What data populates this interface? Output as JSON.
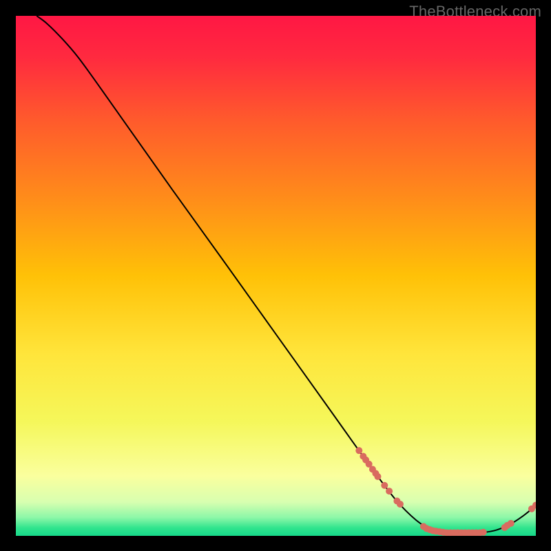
{
  "watermark": {
    "text": "TheBottleneck.com"
  },
  "chart_data": {
    "type": "line",
    "title": "",
    "xlabel": "",
    "ylabel": "",
    "xlim": [
      0,
      100
    ],
    "ylim": [
      0,
      100
    ],
    "grid": false,
    "legend": false,
    "background_gradient": {
      "stops": [
        {
          "offset": 0.0,
          "color": "#ff1744"
        },
        {
          "offset": 0.08,
          "color": "#ff2a3f"
        },
        {
          "offset": 0.2,
          "color": "#ff5a2c"
        },
        {
          "offset": 0.35,
          "color": "#ff8c1a"
        },
        {
          "offset": 0.5,
          "color": "#ffc107"
        },
        {
          "offset": 0.65,
          "color": "#ffe53b"
        },
        {
          "offset": 0.78,
          "color": "#f5f75a"
        },
        {
          "offset": 0.885,
          "color": "#faff9e"
        },
        {
          "offset": 0.935,
          "color": "#d8ffb0"
        },
        {
          "offset": 0.965,
          "color": "#8cf7a8"
        },
        {
          "offset": 0.985,
          "color": "#2fe48d"
        },
        {
          "offset": 1.0,
          "color": "#17d88a"
        }
      ]
    },
    "series": [
      {
        "name": "bottleneck-curve",
        "type": "line",
        "color": "#000000",
        "data": [
          {
            "x": 4.0,
            "y": 100.0
          },
          {
            "x": 6.0,
            "y": 98.5
          },
          {
            "x": 9.0,
            "y": 95.5
          },
          {
            "x": 12.0,
            "y": 92.0
          },
          {
            "x": 16.0,
            "y": 86.5
          },
          {
            "x": 22.0,
            "y": 78.0
          },
          {
            "x": 30.0,
            "y": 66.7
          },
          {
            "x": 40.0,
            "y": 52.8
          },
          {
            "x": 50.0,
            "y": 38.8
          },
          {
            "x": 60.0,
            "y": 24.8
          },
          {
            "x": 68.0,
            "y": 13.6
          },
          {
            "x": 73.0,
            "y": 7.0
          },
          {
            "x": 77.0,
            "y": 3.0
          },
          {
            "x": 80.0,
            "y": 1.2
          },
          {
            "x": 83.0,
            "y": 0.6
          },
          {
            "x": 88.0,
            "y": 0.5
          },
          {
            "x": 92.0,
            "y": 1.0
          },
          {
            "x": 95.0,
            "y": 2.2
          },
          {
            "x": 97.5,
            "y": 3.8
          },
          {
            "x": 100.0,
            "y": 5.8
          }
        ]
      },
      {
        "name": "highlight-dots",
        "type": "scatter",
        "color": "#d96b5f",
        "radius_approx": 5,
        "data": [
          {
            "x": 66.0,
            "y": 16.4
          },
          {
            "x": 66.8,
            "y": 15.3
          },
          {
            "x": 67.3,
            "y": 14.6
          },
          {
            "x": 67.9,
            "y": 13.8
          },
          {
            "x": 68.6,
            "y": 12.8
          },
          {
            "x": 69.2,
            "y": 12.0
          },
          {
            "x": 69.6,
            "y": 11.4
          },
          {
            "x": 70.9,
            "y": 9.7
          },
          {
            "x": 71.8,
            "y": 8.6
          },
          {
            "x": 73.3,
            "y": 6.7
          },
          {
            "x": 73.9,
            "y": 6.1
          },
          {
            "x": 78.4,
            "y": 1.8
          },
          {
            "x": 79.0,
            "y": 1.4
          },
          {
            "x": 79.6,
            "y": 1.2
          },
          {
            "x": 80.2,
            "y": 1.0
          },
          {
            "x": 80.8,
            "y": 0.9
          },
          {
            "x": 81.5,
            "y": 0.8
          },
          {
            "x": 82.2,
            "y": 0.7
          },
          {
            "x": 82.9,
            "y": 0.6
          },
          {
            "x": 83.6,
            "y": 0.6
          },
          {
            "x": 84.3,
            "y": 0.6
          },
          {
            "x": 85.0,
            "y": 0.6
          },
          {
            "x": 85.7,
            "y": 0.6
          },
          {
            "x": 86.4,
            "y": 0.6
          },
          {
            "x": 87.1,
            "y": 0.6
          },
          {
            "x": 87.8,
            "y": 0.6
          },
          {
            "x": 88.5,
            "y": 0.6
          },
          {
            "x": 89.2,
            "y": 0.6
          },
          {
            "x": 89.9,
            "y": 0.7
          },
          {
            "x": 94.0,
            "y": 1.6
          },
          {
            "x": 94.5,
            "y": 2.0
          },
          {
            "x": 95.2,
            "y": 2.4
          },
          {
            "x": 99.2,
            "y": 5.2
          },
          {
            "x": 100.0,
            "y": 5.9
          }
        ]
      }
    ]
  }
}
